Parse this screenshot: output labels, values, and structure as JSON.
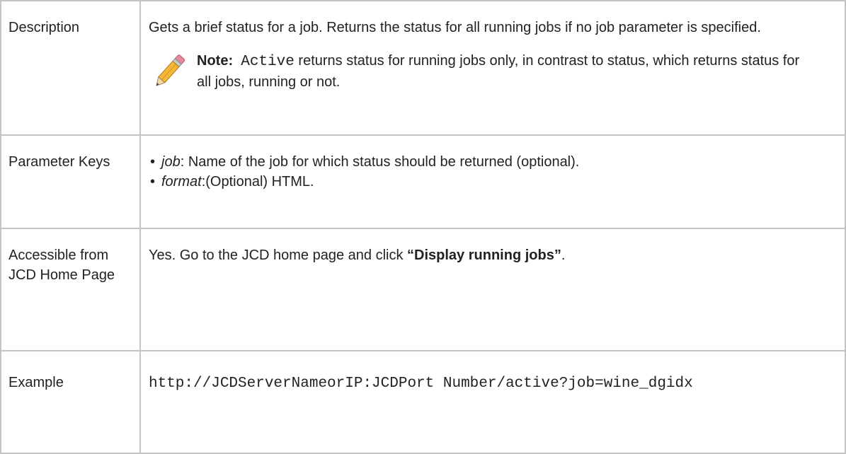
{
  "rows": {
    "description": {
      "label": "Description",
      "text": "Gets a brief status for a job. Returns the status for all running jobs if no job parameter is specified.",
      "note": {
        "label": "Note:",
        "code": "Active",
        "text": " returns status for running jobs only, in contrast to status, which returns status for all jobs, running or not."
      }
    },
    "parameter_keys": {
      "label": "Parameter Keys",
      "items": [
        {
          "key": "job",
          "text": ": Name of the job for which status should be returned (optional)."
        },
        {
          "key": "format",
          "text": ":(Optional) HTML."
        }
      ]
    },
    "accessible": {
      "label": "Accessible from JCD Home Page",
      "text_before": "Yes. Go to the JCD home page and click ",
      "bold": "“Display running jobs”",
      "text_after": "."
    },
    "example": {
      "label": "Example",
      "code": "http://JCDServerNameorIP:JCDPort Number/active?job=wine_dgidx"
    }
  },
  "icons": {
    "note_icon": "pencil-icon"
  }
}
